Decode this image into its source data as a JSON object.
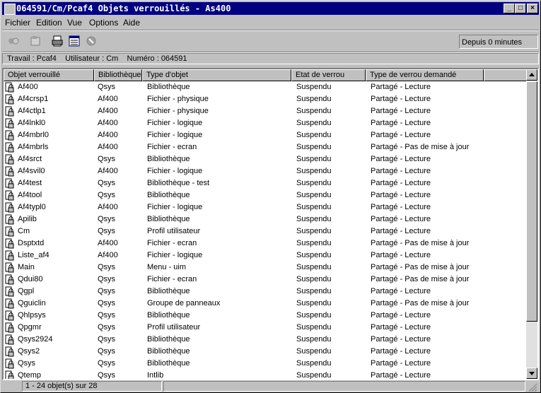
{
  "window": {
    "title": "064591/Cm/Pcaf4 Objets verrouillés - As400",
    "buttons": {
      "minimize": "_",
      "maximize": "□",
      "close": "×"
    }
  },
  "menu": [
    {
      "label": "Fichier"
    },
    {
      "label": "Edition"
    },
    {
      "label": "Vue"
    },
    {
      "label": "Options"
    },
    {
      "label": "Aide"
    }
  ],
  "toolbar": {
    "icons": [
      "connect-icon",
      "properties-icon",
      "print-icon",
      "details-view-icon",
      "stop-icon"
    ],
    "status": "Depuis 0 minutes"
  },
  "info": "Travail : Pcaf4    Utilisateur : Cm    Numéro : 064591",
  "table": {
    "columns": [
      "Objet verrouillé",
      "Bibliothèque",
      "Type d'objet",
      "Etat de verrou",
      "Type de verrou demandé"
    ],
    "rows": [
      [
        "Af400",
        "Qsys",
        "Bibliothèque",
        "Suspendu",
        "Partagé - Lecture"
      ],
      [
        "Af4crsp1",
        "Af400",
        "Fichier - physique",
        "Suspendu",
        "Partagé - Lecture"
      ],
      [
        "Af4ctlp1",
        "Af400",
        "Fichier - physique",
        "Suspendu",
        "Partagé - Lecture"
      ],
      [
        "Af4lnkl0",
        "Af400",
        "Fichier - logique",
        "Suspendu",
        "Partagé - Lecture"
      ],
      [
        "Af4mbrl0",
        "Af400",
        "Fichier - logique",
        "Suspendu",
        "Partagé - Lecture"
      ],
      [
        "Af4mbrls",
        "Af400",
        "Fichier - ecran",
        "Suspendu",
        "Partagé - Pas de mise à jour"
      ],
      [
        "Af4srct",
        "Qsys",
        "Bibliothèque",
        "Suspendu",
        "Partagé - Lecture"
      ],
      [
        "Af4svil0",
        "Af400",
        "Fichier - logique",
        "Suspendu",
        "Partagé - Lecture"
      ],
      [
        "Af4test",
        "Qsys",
        "Bibliothèque - test",
        "Suspendu",
        "Partagé - Lecture"
      ],
      [
        "Af4tool",
        "Qsys",
        "Bibliothèque",
        "Suspendu",
        "Partagé - Lecture"
      ],
      [
        "Af4typl0",
        "Af400",
        "Fichier - logique",
        "Suspendu",
        "Partagé - Lecture"
      ],
      [
        "Apilib",
        "Qsys",
        "Bibliothèque",
        "Suspendu",
        "Partagé - Lecture"
      ],
      [
        "Cm",
        "Qsys",
        "Profil utilisateur",
        "Suspendu",
        "Partagé - Lecture"
      ],
      [
        "Dsptxtd",
        "Af400",
        "Fichier - ecran",
        "Suspendu",
        "Partagé - Pas de mise à jour"
      ],
      [
        "Liste_af4",
        "Af400",
        "Fichier - logique",
        "Suspendu",
        "Partagé - Lecture"
      ],
      [
        "Main",
        "Qsys",
        "Menu - uim",
        "Suspendu",
        "Partagé - Pas de mise à jour"
      ],
      [
        "Qdui80",
        "Qsys",
        "Fichier - ecran",
        "Suspendu",
        "Partagé - Pas de mise à jour"
      ],
      [
        "Qgpl",
        "Qsys",
        "Bibliothèque",
        "Suspendu",
        "Partagé - Lecture"
      ],
      [
        "Qguiclin",
        "Qsys",
        "Groupe de panneaux",
        "Suspendu",
        "Partagé - Pas de mise à jour"
      ],
      [
        "Qhlpsys",
        "Qsys",
        "Bibliothèque",
        "Suspendu",
        "Partagé - Lecture"
      ],
      [
        "Qpgmr",
        "Qsys",
        "Profil utilisateur",
        "Suspendu",
        "Partagé - Lecture"
      ],
      [
        "Qsys2924",
        "Qsys",
        "Bibliothèque",
        "Suspendu",
        "Partagé - Lecture"
      ],
      [
        "Qsys2",
        "Qsys",
        "Bibliothèque",
        "Suspendu",
        "Partagé - Lecture"
      ],
      [
        "Qsys",
        "Qsys",
        "Bibliothèque",
        "Suspendu",
        "Partagé - Lecture"
      ],
      [
        "Qtemp",
        "Qsys",
        "Intlib",
        "Suspendu",
        "Partagé - Lecture"
      ]
    ]
  },
  "status": {
    "text": "1 - 24 objet(s) sur 28"
  }
}
